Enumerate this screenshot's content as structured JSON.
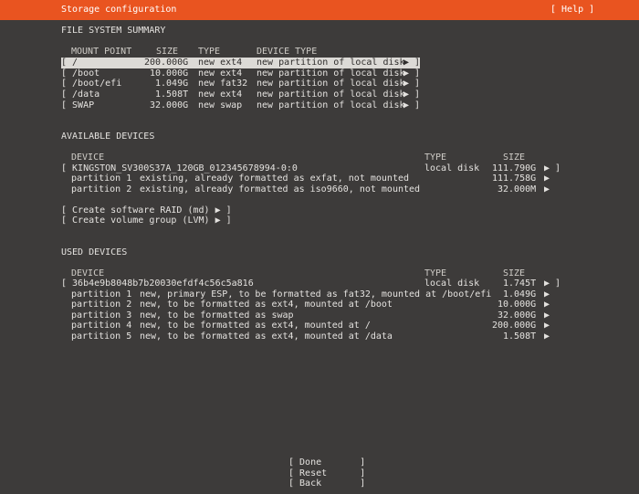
{
  "header": {
    "title": "Storage configuration",
    "help_label": "[ Help ]"
  },
  "fs_summary": {
    "title": "FILE SYSTEM SUMMARY",
    "columns": [
      "MOUNT POINT",
      "SIZE",
      "TYPE",
      "DEVICE TYPE"
    ],
    "rows": [
      {
        "mount": "[ /",
        "size": "200.000G",
        "type": "new ext4",
        "device": "new partition of local disk",
        "arrow": "▶ ]"
      },
      {
        "mount": "[ /boot",
        "size": "10.000G",
        "type": "new ext4",
        "device": "new partition of local disk",
        "arrow": "▶ ]"
      },
      {
        "mount": "[ /boot/efi",
        "size": "1.049G",
        "type": "new fat32",
        "device": "new partition of local disk",
        "arrow": "▶ ]"
      },
      {
        "mount": "[ /data",
        "size": "1.508T",
        "type": "new ext4",
        "device": "new partition of local disk",
        "arrow": "▶ ]"
      },
      {
        "mount": "[ SWAP",
        "size": "32.000G",
        "type": "new swap",
        "device": "new partition of local disk",
        "arrow": "▶ ]"
      }
    ]
  },
  "available": {
    "title": "AVAILABLE DEVICES",
    "columns": [
      "DEVICE",
      "TYPE",
      "SIZE"
    ],
    "disk": {
      "name": "[ KINGSTON_SV300S37A_120GB_012345678994-0:0",
      "type": "local disk",
      "size": "111.790G",
      "arrow": "▶ ]"
    },
    "partitions": [
      {
        "name": "partition 1",
        "desc": "existing, already formatted as exfat, not mounted",
        "size": "111.758G",
        "arrow": "▶"
      },
      {
        "name": "partition 2",
        "desc": "existing, already formatted as iso9660, not mounted",
        "size": "32.000M",
        "arrow": "▶"
      }
    ],
    "actions": [
      "[ Create software RAID (md) ▶ ]",
      "[ Create volume group (LVM) ▶ ]"
    ]
  },
  "used": {
    "title": "USED DEVICES",
    "columns": [
      "DEVICE",
      "TYPE",
      "SIZE"
    ],
    "disk": {
      "name": "[ 36b4e9b8048b7b20030efdf4c56c5a816",
      "type": "local disk",
      "size": "1.745T",
      "arrow": "▶ ]"
    },
    "partitions": [
      {
        "name": "partition 1",
        "desc": "new, primary ESP, to be formatted as fat32, mounted at /boot/efi",
        "size": "1.049G",
        "arrow": "▶"
      },
      {
        "name": "partition 2",
        "desc": "new, to be formatted as ext4, mounted at /boot",
        "size": "10.000G",
        "arrow": "▶"
      },
      {
        "name": "partition 3",
        "desc": "new, to be formatted as swap",
        "size": "32.000G",
        "arrow": "▶"
      },
      {
        "name": "partition 4",
        "desc": "new, to be formatted as ext4, mounted at /",
        "size": "200.000G",
        "arrow": "▶"
      },
      {
        "name": "partition 5",
        "desc": "new, to be formatted as ext4, mounted at /data",
        "size": "1.508T",
        "arrow": "▶"
      }
    ]
  },
  "buttons": {
    "done": "[ Done       ]",
    "reset": "[ Reset      ]",
    "back": "[ Back       ]"
  }
}
